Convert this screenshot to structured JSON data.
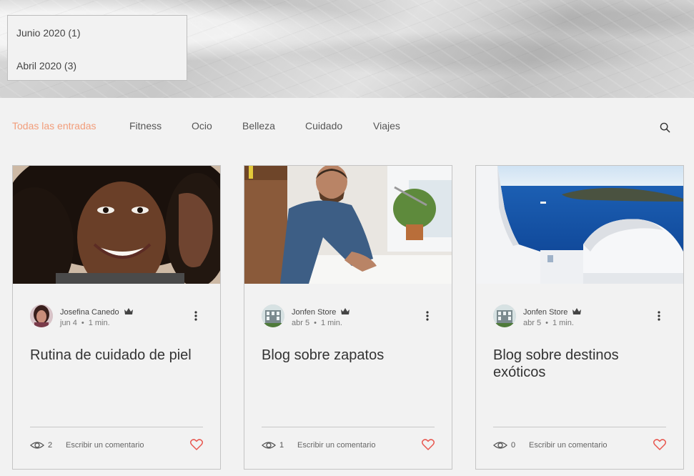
{
  "archive": {
    "items": [
      "Junio 2020 (1)",
      "Abril 2020 (3)"
    ]
  },
  "nav": {
    "items": [
      "Todas las entradas",
      "Fitness",
      "Ocio",
      "Belleza",
      "Cuidado",
      "Viajes"
    ],
    "active_index": 0,
    "search_icon": "search-icon"
  },
  "colors": {
    "active_tab": "#f29d7a",
    "heart": "#e8574f",
    "background": "#f2f2f2"
  },
  "posts": [
    {
      "author": "Josefina Canedo",
      "date": "jun 4",
      "read_time": "1 min.",
      "title": "Rutina de cuidado de piel",
      "views": "2",
      "comment_label": "Escribir un comentario"
    },
    {
      "author": "Jonfen Store",
      "date": "abr 5",
      "read_time": "1 min.",
      "title": "Blog sobre zapatos",
      "views": "1",
      "comment_label": "Escribir un comentario"
    },
    {
      "author": "Jonfen Store",
      "date": "abr 5",
      "read_time": "1 min.",
      "title": "Blog sobre destinos exóticos",
      "views": "0",
      "comment_label": "Escribir un comentario"
    }
  ]
}
